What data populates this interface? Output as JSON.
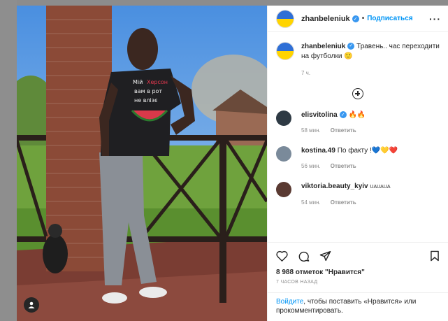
{
  "post": {
    "username": "zhanbeleniuk",
    "follow_label": "Подписаться",
    "dot": "•",
    "more": "···",
    "caption": "Травень.. час переходити на футболки 🙂",
    "caption_time": "7 ч.",
    "likes": "8 988 отметок \"Нравится\"",
    "ago": "7 ЧАСОВ НАЗАД",
    "shirt_text": [
      "Мій",
      "Херсон",
      "вам в рот",
      "не влізє"
    ]
  },
  "comments": [
    {
      "user": "elisvitolina",
      "verified": true,
      "text": "🔥🔥",
      "time": "58 мин.",
      "reply": "Ответить",
      "avatar_color": "#2e3a44"
    },
    {
      "user": "kostina.49",
      "verified": false,
      "text": "По факту !💙💛❤️",
      "time": "56 мин.",
      "reply": "Ответить",
      "avatar_color": "#7a8a9a"
    },
    {
      "user": "viktoria.beauty_kyiv",
      "verified": false,
      "text": "UAUAUA",
      "time": "54 мин.",
      "reply": "Ответить",
      "avatar_color": "#5a3a32"
    }
  ],
  "login": {
    "link": "Войдите",
    "rest": ", чтобы поставить «Нравится» или прокомментировать."
  },
  "colors": {
    "accent": "#0095f6",
    "verified": "#3897f0",
    "flag_blue": "#2f6fd6",
    "flag_yellow": "#ffd400"
  }
}
